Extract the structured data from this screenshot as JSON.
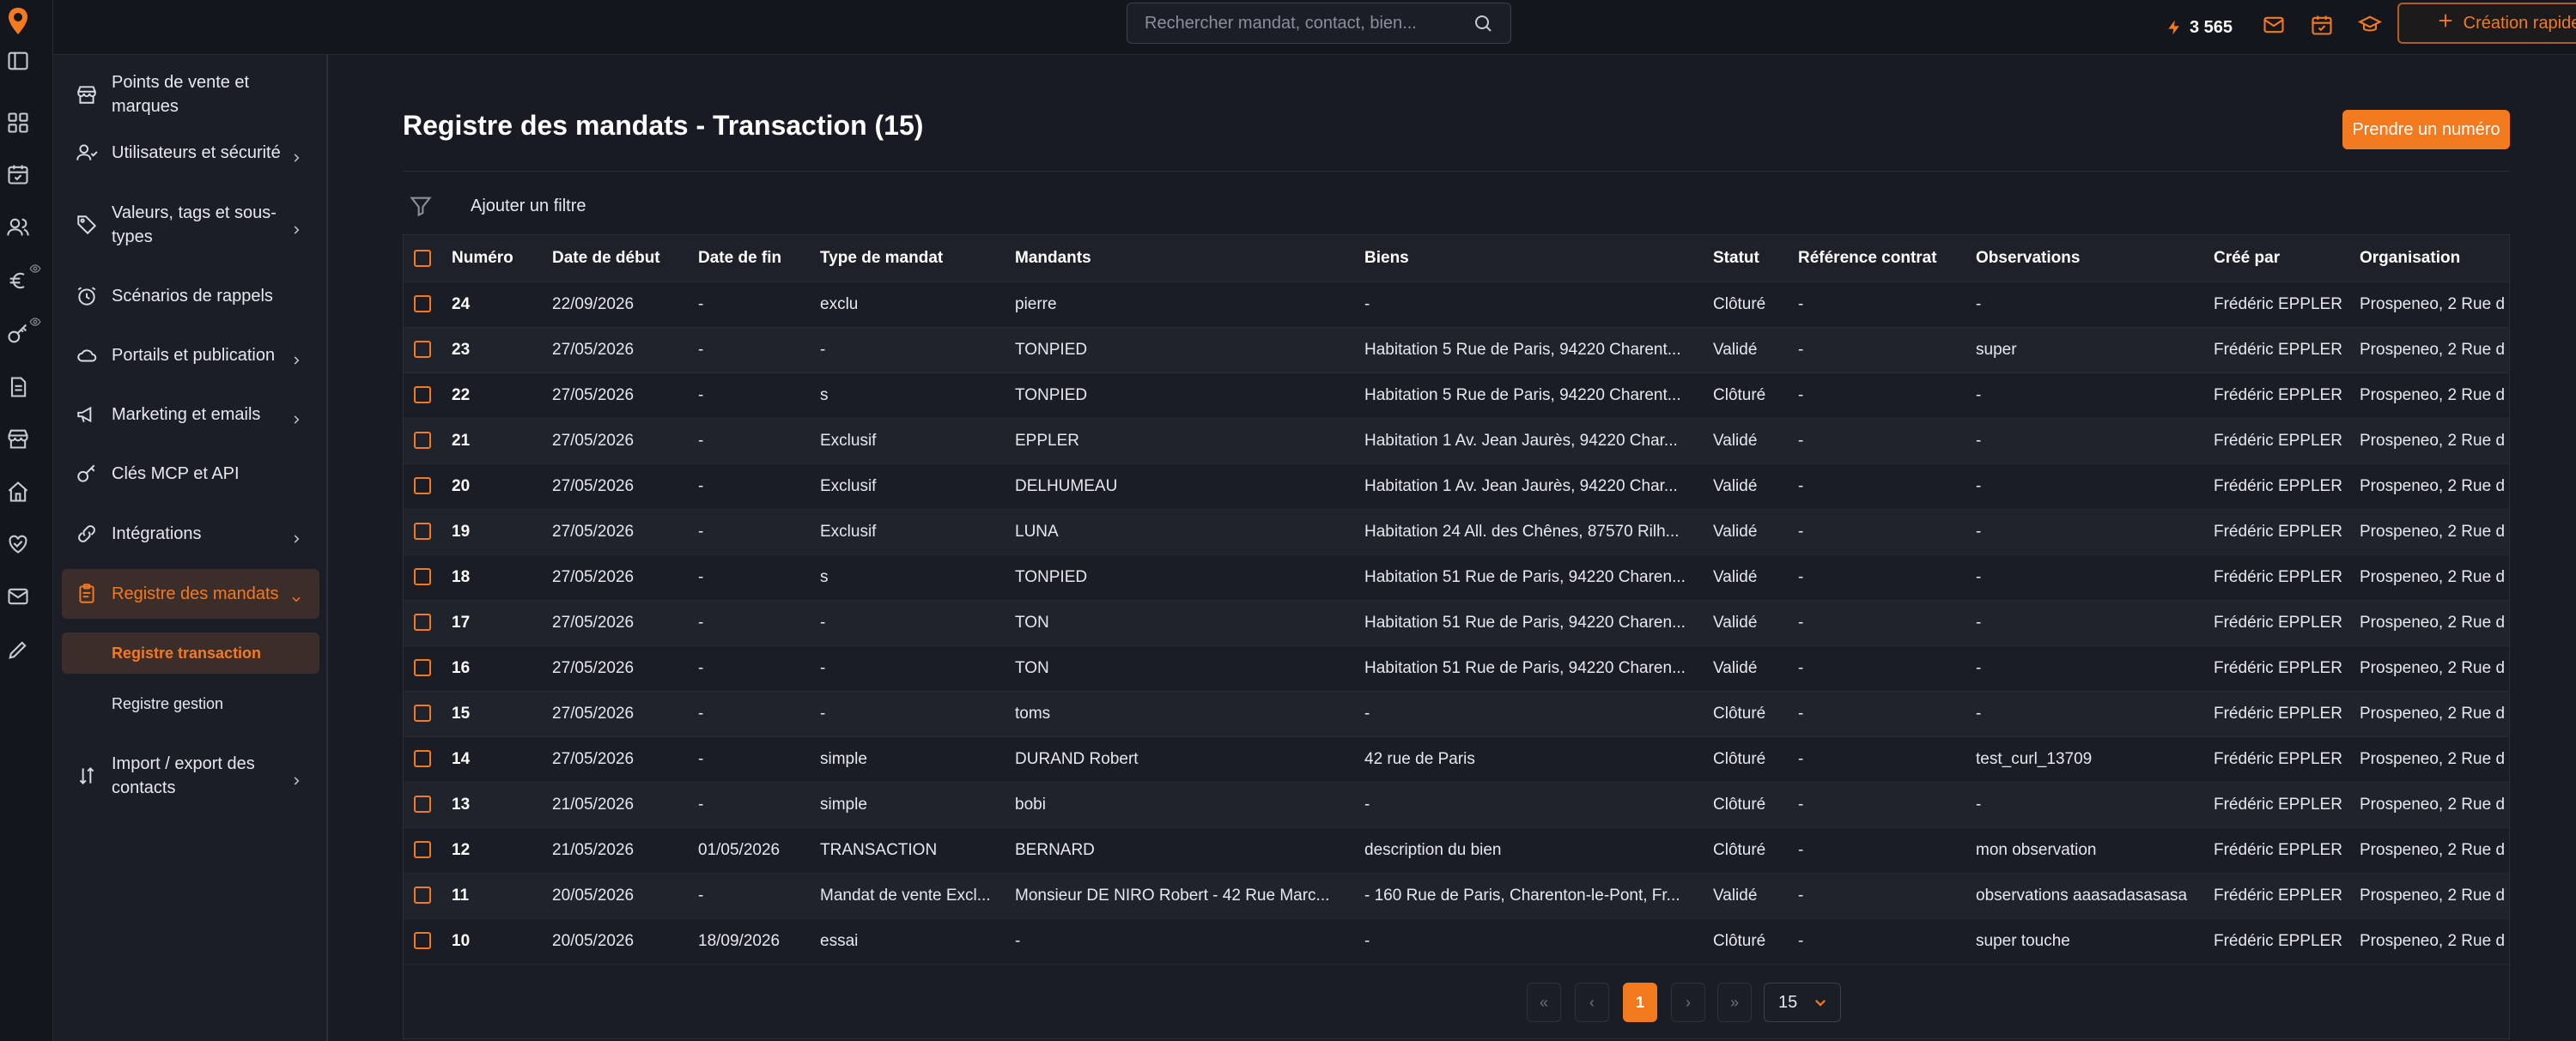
{
  "topbar": {
    "search_placeholder": "Rechercher mandat, contact, bien...",
    "credits": "3 565",
    "quick_create": "Création rapide"
  },
  "sidebar": {
    "items": [
      {
        "label": "Points de vente et marques",
        "icon": "store-icon",
        "has_chevron": false
      },
      {
        "label": "Utilisateurs et sécurité",
        "icon": "users-icon",
        "has_chevron": true
      },
      {
        "label": "Valeurs, tags et sous-types",
        "icon": "tag-icon",
        "has_chevron": true
      },
      {
        "label": "Scénarios de rappels",
        "icon": "alarm-clock-icon",
        "has_chevron": false
      },
      {
        "label": "Portails et publication",
        "icon": "cloud-icon",
        "has_chevron": true
      },
      {
        "label": "Marketing et emails",
        "icon": "megaphone-icon",
        "has_chevron": true
      },
      {
        "label": "Clés MCP et API",
        "icon": "key-icon",
        "has_chevron": false
      },
      {
        "label": "Intégrations",
        "icon": "link-icon",
        "has_chevron": true
      },
      {
        "label": "Registre des mandats",
        "icon": "clipboard-icon",
        "has_chevron": true
      },
      {
        "label": "Import / export des contacts",
        "icon": "arrows-updown-icon",
        "has_chevron": true
      }
    ],
    "sub_items": [
      {
        "label": "Registre transaction"
      },
      {
        "label": "Registre gestion"
      }
    ]
  },
  "main": {
    "title": "Registre des mandats - Transaction (15)",
    "primary_action": "Prendre un numéro",
    "add_filter": "Ajouter un filtre"
  },
  "table": {
    "columns": [
      "Numéro",
      "Date de début",
      "Date de fin",
      "Type de mandat",
      "Mandants",
      "Biens",
      "Statut",
      "Référence contrat",
      "Observations",
      "Créé par",
      "Organisation"
    ],
    "rows": [
      [
        "24",
        "22/09/2026",
        "-",
        "exclu",
        "pierre",
        "-",
        "Clôturé",
        "-",
        "-",
        "Frédéric EPPLER",
        "Prospeneo, 2 Rue d"
      ],
      [
        "23",
        "27/05/2026",
        "-",
        "-",
        "TONPIED",
        "Habitation 5 Rue de Paris, 94220 Charent...",
        "Validé",
        "-",
        "super",
        "Frédéric EPPLER",
        "Prospeneo, 2 Rue d"
      ],
      [
        "22",
        "27/05/2026",
        "-",
        "s",
        "TONPIED",
        "Habitation 5 Rue de Paris, 94220 Charent...",
        "Clôturé",
        "-",
        "-",
        "Frédéric EPPLER",
        "Prospeneo, 2 Rue d"
      ],
      [
        "21",
        "27/05/2026",
        "-",
        "Exclusif",
        "EPPLER",
        "Habitation 1 Av. Jean Jaurès, 94220 Char...",
        "Validé",
        "-",
        "-",
        "Frédéric EPPLER",
        "Prospeneo, 2 Rue d"
      ],
      [
        "20",
        "27/05/2026",
        "-",
        "Exclusif",
        "DELHUMEAU",
        "Habitation 1 Av. Jean Jaurès, 94220 Char...",
        "Validé",
        "-",
        "-",
        "Frédéric EPPLER",
        "Prospeneo, 2 Rue d"
      ],
      [
        "19",
        "27/05/2026",
        "-",
        "Exclusif",
        "LUNA",
        "Habitation 24 All. des Chênes, 87570 Rilh...",
        "Validé",
        "-",
        "-",
        "Frédéric EPPLER",
        "Prospeneo, 2 Rue d"
      ],
      [
        "18",
        "27/05/2026",
        "-",
        "s",
        "TONPIED",
        "Habitation 51 Rue de Paris, 94220 Charen...",
        "Validé",
        "-",
        "-",
        "Frédéric EPPLER",
        "Prospeneo, 2 Rue d"
      ],
      [
        "17",
        "27/05/2026",
        "-",
        "-",
        "TON",
        "Habitation 51 Rue de Paris, 94220 Charen...",
        "Validé",
        "-",
        "-",
        "Frédéric EPPLER",
        "Prospeneo, 2 Rue d"
      ],
      [
        "16",
        "27/05/2026",
        "-",
        "-",
        "TON",
        "Habitation 51 Rue de Paris, 94220 Charen...",
        "Validé",
        "-",
        "-",
        "Frédéric EPPLER",
        "Prospeneo, 2 Rue d"
      ],
      [
        "15",
        "27/05/2026",
        "-",
        "-",
        "toms",
        "-",
        "Clôturé",
        "-",
        "-",
        "Frédéric EPPLER",
        "Prospeneo, 2 Rue d"
      ],
      [
        "14",
        "27/05/2026",
        "-",
        "simple",
        "DURAND Robert",
        "42 rue de Paris",
        "Clôturé",
        "-",
        "test_curl_13709",
        "Frédéric EPPLER",
        "Prospeneo, 2 Rue d"
      ],
      [
        "13",
        "21/05/2026",
        "-",
        "simple",
        "bobi",
        "-",
        "Clôturé",
        "-",
        "-",
        "Frédéric EPPLER",
        "Prospeneo, 2 Rue d"
      ],
      [
        "12",
        "21/05/2026",
        "01/05/2026",
        "TRANSACTION",
        "BERNARD",
        "description du bien",
        "Clôturé",
        "-",
        "mon observation",
        "Frédéric EPPLER",
        "Prospeneo, 2 Rue d"
      ],
      [
        "11",
        "20/05/2026",
        "-",
        "Mandat de vente Excl...",
        "Monsieur DE NIRO Robert - 42 Rue Marc...",
        "- 160 Rue de Paris, Charenton-le-Pont, Fr...",
        "Validé",
        "-",
        "observations aaasadasasasa",
        "Frédéric EPPLER",
        "Prospeneo, 2 Rue d"
      ],
      [
        "10",
        "20/05/2026",
        "18/09/2026",
        "essai",
        "-",
        "-",
        "Clôturé",
        "-",
        "super touche",
        "Frédéric EPPLER",
        "Prospeneo, 2 Rue d"
      ]
    ]
  },
  "pagination": {
    "first": "«",
    "prev": "‹",
    "current": "1",
    "next": "›",
    "last": "»",
    "page_size": "15"
  },
  "colors": {
    "accent": "#f47a1f",
    "background": "#181b24"
  }
}
